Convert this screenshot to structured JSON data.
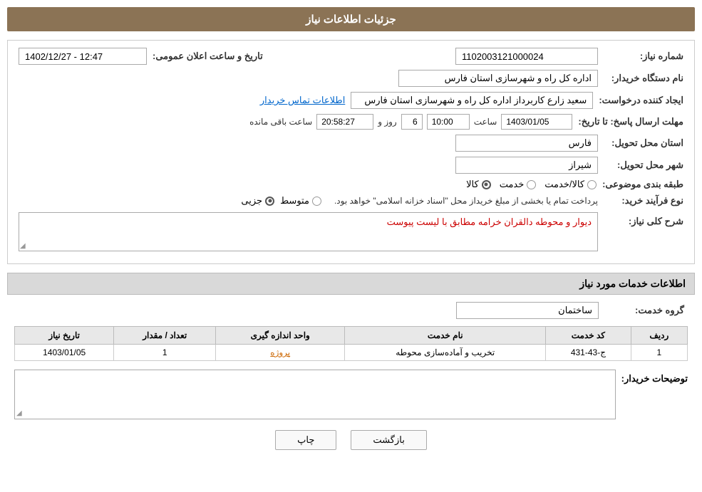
{
  "page": {
    "title": "جزئیات اطلاعات نیاز",
    "sections": {
      "main_info": {
        "need_number_label": "شماره نیاز:",
        "need_number_value": "1102003121000024",
        "announce_datetime_label": "تاریخ و ساعت اعلان عمومی:",
        "announce_datetime_value": "1402/12/27 - 12:47",
        "buyer_org_label": "نام دستگاه خریدار:",
        "buyer_org_value": "اداره کل راه و شهرسازی استان فارس",
        "creator_label": "ایجاد کننده درخواست:",
        "creator_value": "سعید زارع کاربرداز اداره کل راه و شهرسازی استان فارس",
        "contact_link": "اطلاعات تماس خریدار",
        "deadline_label": "مهلت ارسال پاسخ: تا تاریخ:",
        "deadline_date": "1403/01/05",
        "deadline_time_label": "ساعت",
        "deadline_time": "10:00",
        "remaining_days_label": "روز و",
        "remaining_days": "6",
        "remaining_time_label": "ساعت باقی مانده",
        "remaining_time": "20:58:27",
        "province_label": "استان محل تحویل:",
        "province_value": "فارس",
        "city_label": "شهر محل تحویل:",
        "city_value": "شیراز",
        "category_label": "طبقه بندی موضوعی:",
        "category_options": [
          "کالا",
          "خدمت",
          "کالا/خدمت"
        ],
        "category_selected": "کالا",
        "process_label": "نوع فرآیند خرید:",
        "process_options": [
          "جزیی",
          "متوسط"
        ],
        "process_note": "پرداخت تمام یا بخشی از مبلغ خریداز محل \"اسناد خزانه اسلامی\" خواهد بود.",
        "need_description_label": "شرح کلی نیاز:",
        "need_description_value": "دیوار و محوطه دالقران خرامه مطابق با لیست پیوست"
      },
      "services_info": {
        "title": "اطلاعات خدمات مورد نیاز",
        "service_group_label": "گروه خدمت:",
        "service_group_value": "ساختمان",
        "table": {
          "columns": [
            "ردیف",
            "کد خدمت",
            "نام خدمت",
            "واحد اندازه گیری",
            "تعداد / مقدار",
            "تاریخ نیاز"
          ],
          "rows": [
            {
              "row_num": "1",
              "service_code": "ج-43-431",
              "service_name": "تخریب و آماده‌سازی محوطه",
              "unit": "پروژه",
              "quantity": "1",
              "date": "1403/01/05"
            }
          ]
        }
      },
      "buyer_notes": {
        "label": "توضیحات خریدار:",
        "value": ""
      }
    },
    "buttons": {
      "back_label": "بازگشت",
      "print_label": "چاپ"
    }
  }
}
